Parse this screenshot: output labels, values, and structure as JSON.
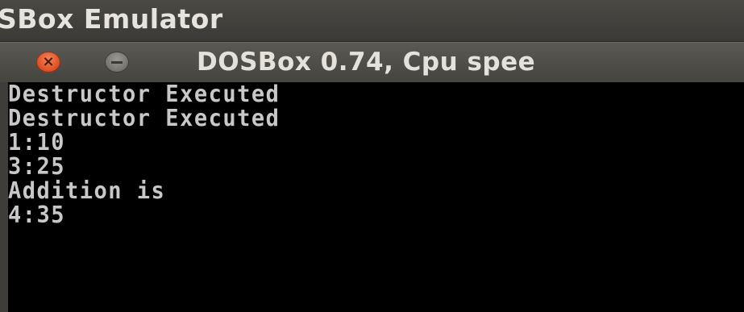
{
  "desktop": {
    "app_title": "SBox Emulator"
  },
  "window": {
    "title": "DOSBox 0.74, Cpu spee",
    "close_glyph": "×"
  },
  "console": {
    "lines": [
      "Destructor Executed",
      "Destructor Executed",
      "1:10",
      "3:25",
      "Addition is",
      "4:35"
    ]
  },
  "colors": {
    "console_background": "#000000",
    "console_text": "#c8c8c8",
    "close_button": "#e2552a",
    "titlebar": "#4f4e49"
  }
}
